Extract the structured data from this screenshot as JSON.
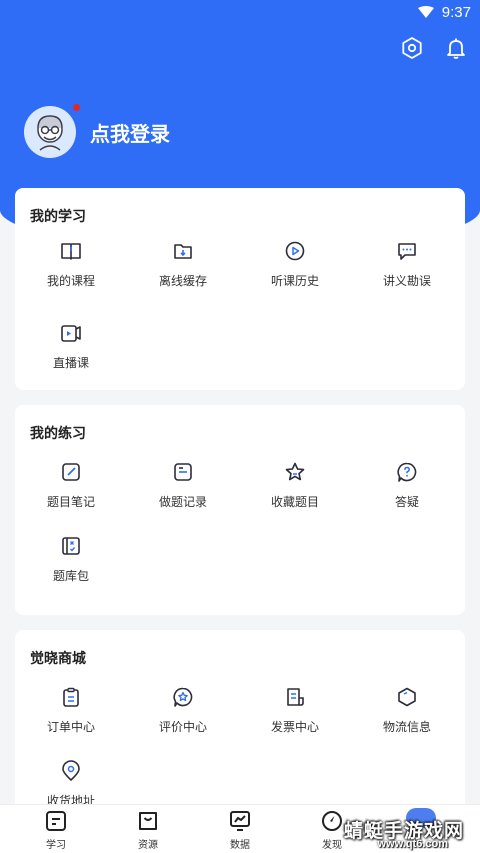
{
  "status_bar": {
    "time": "9:37"
  },
  "header": {
    "login_text": "点我登录"
  },
  "colors": {
    "brand": "#2f6df6",
    "badge": "#e3262b"
  },
  "icons": {
    "settings": "settings-icon",
    "notification": "bell-icon"
  },
  "my_learning": {
    "title": "我的学习",
    "items": [
      {
        "label": "我的课程",
        "icon": "book-icon"
      },
      {
        "label": "离线缓存",
        "icon": "download-folder-icon"
      },
      {
        "label": "听课历史",
        "icon": "play-circle-icon"
      },
      {
        "label": "讲义勘误",
        "icon": "chat-bubble-icon"
      },
      {
        "label": "直播课",
        "icon": "live-icon"
      }
    ]
  },
  "my_practice": {
    "title": "我的练习",
    "items": [
      {
        "label": "题目笔记",
        "icon": "edit-icon"
      },
      {
        "label": "做题记录",
        "icon": "record-icon"
      },
      {
        "label": "收藏题目",
        "icon": "star-icon"
      },
      {
        "label": "答疑",
        "icon": "question-icon"
      },
      {
        "label": "题库包",
        "icon": "quiz-pack-icon"
      }
    ]
  },
  "mall": {
    "title": "觉晓商城",
    "items": [
      {
        "label": "订单中心",
        "icon": "clipboard-icon"
      },
      {
        "label": "评价中心",
        "icon": "review-star-icon"
      },
      {
        "label": "发票中心",
        "icon": "invoice-icon"
      },
      {
        "label": "物流信息",
        "icon": "package-icon"
      },
      {
        "label": "收货地址",
        "icon": "location-icon"
      }
    ]
  },
  "tabbar": {
    "tabs": [
      {
        "label": "学习",
        "icon": "study-icon"
      },
      {
        "label": "资源",
        "icon": "resource-bag-icon"
      },
      {
        "label": "数据",
        "icon": "chart-monitor-icon"
      },
      {
        "label": "发现",
        "icon": "compass-icon"
      }
    ]
  },
  "watermark": {
    "text": "蜻蜓手游戏网",
    "url": "www.qt6.com"
  }
}
